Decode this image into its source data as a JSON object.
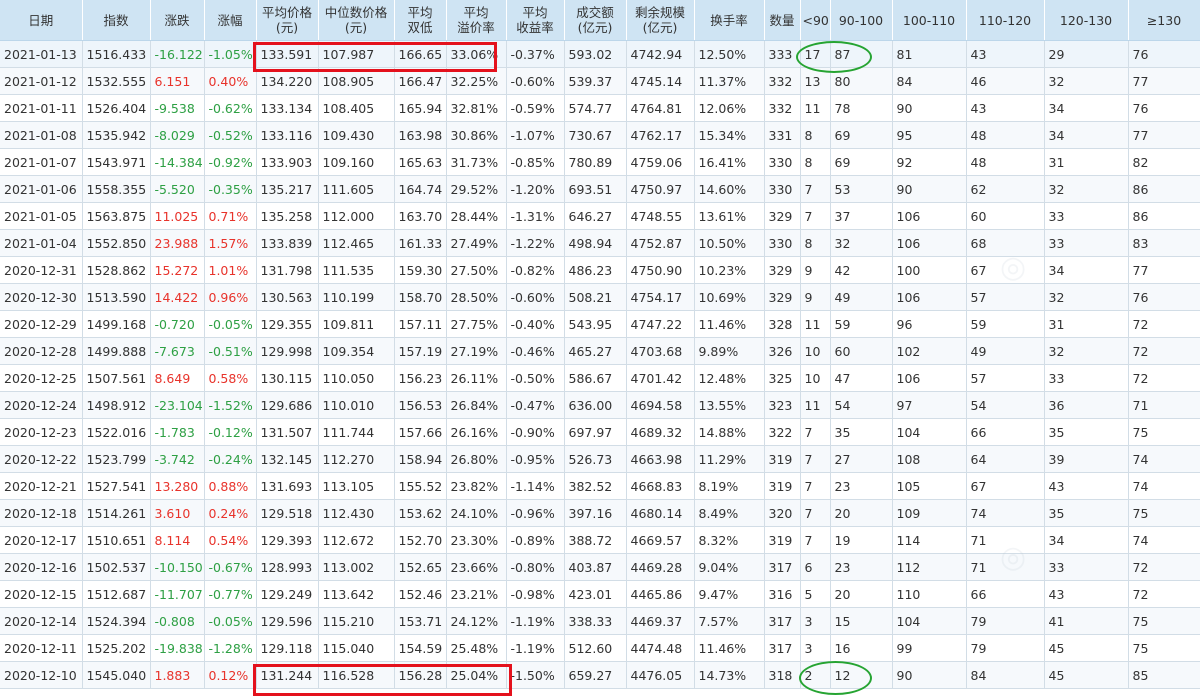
{
  "columns": [
    "日期",
    "指数",
    "涨跌",
    "涨幅",
    "平均价格\n(元)",
    "中位数价格\n(元)",
    "平均\n双低",
    "平均\n溢价率",
    "平均\n收益率",
    "成交额\n(亿元)",
    "剩余规模\n(亿元)",
    "换手率",
    "数量",
    "<90",
    "90-100",
    "100-110",
    "110-120",
    "120-130",
    "≥130"
  ],
  "rows": [
    [
      "2021-01-13",
      "1516.433",
      "-16.122",
      "-1.05%",
      "133.591",
      "107.987",
      "166.65",
      "33.06%",
      "-0.37%",
      "593.02",
      "4742.94",
      "12.50%",
      "333",
      "17",
      "87",
      "81",
      "43",
      "29",
      "76"
    ],
    [
      "2021-01-12",
      "1532.555",
      "6.151",
      "0.40%",
      "134.220",
      "108.905",
      "166.47",
      "32.25%",
      "-0.60%",
      "539.37",
      "4745.14",
      "11.37%",
      "332",
      "13",
      "80",
      "84",
      "46",
      "32",
      "77"
    ],
    [
      "2021-01-11",
      "1526.404",
      "-9.538",
      "-0.62%",
      "133.134",
      "108.405",
      "165.94",
      "32.81%",
      "-0.59%",
      "574.77",
      "4764.81",
      "12.06%",
      "332",
      "11",
      "78",
      "90",
      "43",
      "34",
      "76"
    ],
    [
      "2021-01-08",
      "1535.942",
      "-8.029",
      "-0.52%",
      "133.116",
      "109.430",
      "163.98",
      "30.86%",
      "-1.07%",
      "730.67",
      "4762.17",
      "15.34%",
      "331",
      "8",
      "69",
      "95",
      "48",
      "34",
      "77"
    ],
    [
      "2021-01-07",
      "1543.971",
      "-14.384",
      "-0.92%",
      "133.903",
      "109.160",
      "165.63",
      "31.73%",
      "-0.85%",
      "780.89",
      "4759.06",
      "16.41%",
      "330",
      "8",
      "69",
      "92",
      "48",
      "31",
      "82"
    ],
    [
      "2021-01-06",
      "1558.355",
      "-5.520",
      "-0.35%",
      "135.217",
      "111.605",
      "164.74",
      "29.52%",
      "-1.20%",
      "693.51",
      "4750.97",
      "14.60%",
      "330",
      "7",
      "53",
      "90",
      "62",
      "32",
      "86"
    ],
    [
      "2021-01-05",
      "1563.875",
      "11.025",
      "0.71%",
      "135.258",
      "112.000",
      "163.70",
      "28.44%",
      "-1.31%",
      "646.27",
      "4748.55",
      "13.61%",
      "329",
      "7",
      "37",
      "106",
      "60",
      "33",
      "86"
    ],
    [
      "2021-01-04",
      "1552.850",
      "23.988",
      "1.57%",
      "133.839",
      "112.465",
      "161.33",
      "27.49%",
      "-1.22%",
      "498.94",
      "4752.87",
      "10.50%",
      "330",
      "8",
      "32",
      "106",
      "68",
      "33",
      "83"
    ],
    [
      "2020-12-31",
      "1528.862",
      "15.272",
      "1.01%",
      "131.798",
      "111.535",
      "159.30",
      "27.50%",
      "-0.82%",
      "486.23",
      "4750.90",
      "10.23%",
      "329",
      "9",
      "42",
      "100",
      "67",
      "34",
      "77"
    ],
    [
      "2020-12-30",
      "1513.590",
      "14.422",
      "0.96%",
      "130.563",
      "110.199",
      "158.70",
      "28.50%",
      "-0.60%",
      "508.21",
      "4754.17",
      "10.69%",
      "329",
      "9",
      "49",
      "106",
      "57",
      "32",
      "76"
    ],
    [
      "2020-12-29",
      "1499.168",
      "-0.720",
      "-0.05%",
      "129.355",
      "109.811",
      "157.11",
      "27.75%",
      "-0.40%",
      "543.95",
      "4747.22",
      "11.46%",
      "328",
      "11",
      "59",
      "96",
      "59",
      "31",
      "72"
    ],
    [
      "2020-12-28",
      "1499.888",
      "-7.673",
      "-0.51%",
      "129.998",
      "109.354",
      "157.19",
      "27.19%",
      "-0.46%",
      "465.27",
      "4703.68",
      "9.89%",
      "326",
      "10",
      "60",
      "102",
      "49",
      "32",
      "72"
    ],
    [
      "2020-12-25",
      "1507.561",
      "8.649",
      "0.58%",
      "130.115",
      "110.050",
      "156.23",
      "26.11%",
      "-0.50%",
      "586.67",
      "4701.42",
      "12.48%",
      "325",
      "10",
      "47",
      "106",
      "57",
      "33",
      "72"
    ],
    [
      "2020-12-24",
      "1498.912",
      "-23.104",
      "-1.52%",
      "129.686",
      "110.010",
      "156.53",
      "26.84%",
      "-0.47%",
      "636.00",
      "4694.58",
      "13.55%",
      "323",
      "11",
      "54",
      "97",
      "54",
      "36",
      "71"
    ],
    [
      "2020-12-23",
      "1522.016",
      "-1.783",
      "-0.12%",
      "131.507",
      "111.744",
      "157.66",
      "26.16%",
      "-0.90%",
      "697.97",
      "4689.32",
      "14.88%",
      "322",
      "7",
      "35",
      "104",
      "66",
      "35",
      "75"
    ],
    [
      "2020-12-22",
      "1523.799",
      "-3.742",
      "-0.24%",
      "132.145",
      "112.270",
      "158.94",
      "26.80%",
      "-0.95%",
      "526.73",
      "4663.98",
      "11.29%",
      "319",
      "7",
      "27",
      "108",
      "64",
      "39",
      "74"
    ],
    [
      "2020-12-21",
      "1527.541",
      "13.280",
      "0.88%",
      "131.693",
      "113.105",
      "155.52",
      "23.82%",
      "-1.14%",
      "382.52",
      "4668.83",
      "8.19%",
      "319",
      "7",
      "23",
      "105",
      "67",
      "43",
      "74"
    ],
    [
      "2020-12-18",
      "1514.261",
      "3.610",
      "0.24%",
      "129.518",
      "112.430",
      "153.62",
      "24.10%",
      "-0.96%",
      "397.16",
      "4680.14",
      "8.49%",
      "320",
      "7",
      "20",
      "109",
      "74",
      "35",
      "75"
    ],
    [
      "2020-12-17",
      "1510.651",
      "8.114",
      "0.54%",
      "129.393",
      "112.672",
      "152.70",
      "23.30%",
      "-0.89%",
      "388.72",
      "4669.57",
      "8.32%",
      "319",
      "7",
      "19",
      "114",
      "71",
      "34",
      "74"
    ],
    [
      "2020-12-16",
      "1502.537",
      "-10.150",
      "-0.67%",
      "128.993",
      "113.002",
      "152.65",
      "23.66%",
      "-0.80%",
      "403.87",
      "4469.28",
      "9.04%",
      "317",
      "6",
      "23",
      "112",
      "71",
      "33",
      "72"
    ],
    [
      "2020-12-15",
      "1512.687",
      "-11.707",
      "-0.77%",
      "129.249",
      "113.642",
      "152.46",
      "23.21%",
      "-0.98%",
      "423.01",
      "4465.86",
      "9.47%",
      "316",
      "5",
      "20",
      "110",
      "66",
      "43",
      "72"
    ],
    [
      "2020-12-14",
      "1524.394",
      "-0.808",
      "-0.05%",
      "129.596",
      "115.210",
      "153.71",
      "24.12%",
      "-1.19%",
      "338.33",
      "4469.37",
      "7.57%",
      "317",
      "3",
      "15",
      "104",
      "79",
      "41",
      "75"
    ],
    [
      "2020-12-11",
      "1525.202",
      "-19.838",
      "-1.28%",
      "129.118",
      "115.040",
      "154.59",
      "25.48%",
      "-1.19%",
      "512.60",
      "4474.48",
      "11.46%",
      "317",
      "3",
      "16",
      "99",
      "79",
      "45",
      "75"
    ],
    [
      "2020-12-10",
      "1545.040",
      "1.883",
      "0.12%",
      "131.244",
      "116.528",
      "156.28",
      "25.04%",
      "-1.50%",
      "659.27",
      "4476.05",
      "14.73%",
      "318",
      "2",
      "12",
      "90",
      "84",
      "45",
      "85"
    ]
  ],
  "colors": {
    "up": "#e8332b",
    "down": "#2ea044",
    "highlight_box": "#e4111c",
    "highlight_circle": "#26a432",
    "header_bg": "#cfe4f3"
  }
}
